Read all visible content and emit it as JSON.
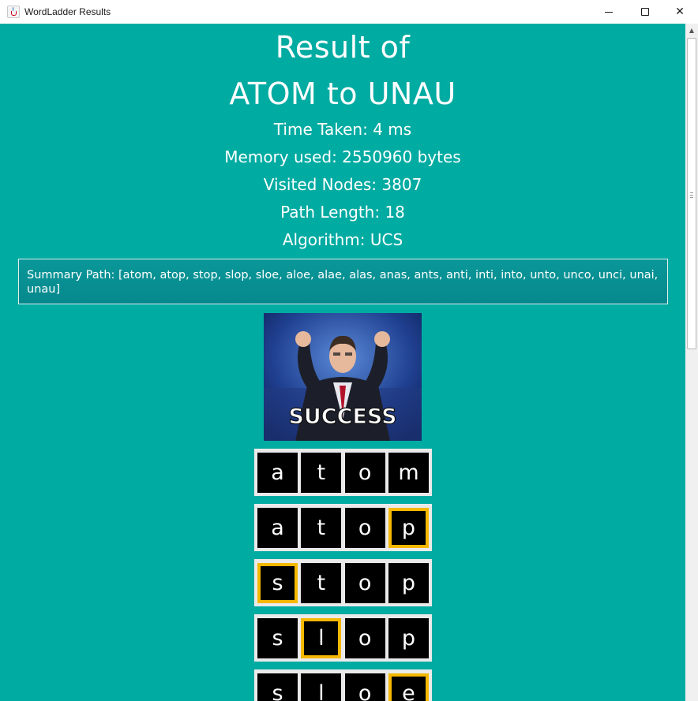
{
  "window": {
    "title": "WordLadder Results",
    "controls": {
      "minimize": "",
      "maximize": "",
      "close": "✕"
    }
  },
  "result": {
    "title_line1": "Result of",
    "title_line2": "ATOM to UNAU",
    "time_taken": "Time Taken: 4 ms",
    "memory_used": "Memory used: 2550960 bytes",
    "visited_nodes": "Visited Nodes: 3807",
    "path_length": "Path Length: 18",
    "algorithm": "Algorithm: UCS"
  },
  "summary": {
    "text": "Summary Path: [atom, atop, stop, slop, sloe, aloe, alae, alas, anas, ants, anti, inti, into, unto, unco, unci, unai, unau]"
  },
  "success_image": {
    "caption": "SUCCESS"
  },
  "ladder": {
    "rows": [
      {
        "letters": [
          "a",
          "t",
          "o",
          "m"
        ],
        "changed_index": -1
      },
      {
        "letters": [
          "a",
          "t",
          "o",
          "p"
        ],
        "changed_index": 3
      },
      {
        "letters": [
          "s",
          "t",
          "o",
          "p"
        ],
        "changed_index": 0
      },
      {
        "letters": [
          "s",
          "l",
          "o",
          "p"
        ],
        "changed_index": 1
      },
      {
        "letters": [
          "s",
          "l",
          "o",
          "e"
        ],
        "changed_index": 3
      }
    ]
  },
  "colors": {
    "background": "#00ABA2",
    "highlight": "#F5B800",
    "cell": "#000000",
    "text": "#FFFFFF"
  }
}
